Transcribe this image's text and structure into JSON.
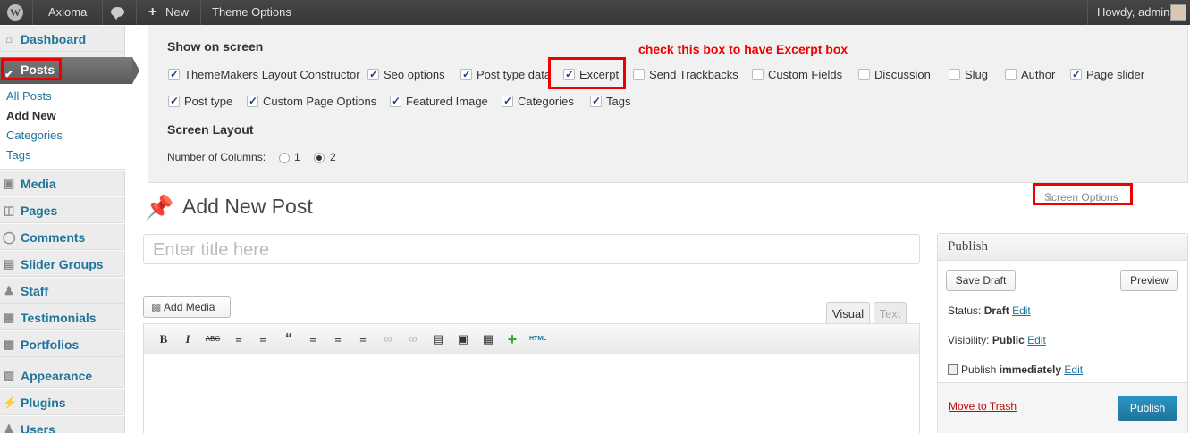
{
  "adminbar": {
    "site_name": "Axioma",
    "new_label": "New",
    "theme_options": "Theme Options",
    "howdy": "Howdy, admin"
  },
  "sidebar": {
    "dashboard": "Dashboard",
    "posts": "Posts",
    "submenu": [
      "All Posts",
      "Add New",
      "Categories",
      "Tags"
    ],
    "items": [
      "Media",
      "Pages",
      "Comments",
      "Slider Groups",
      "Staff",
      "Testimonials",
      "Portfolios",
      "Appearance",
      "Plugins",
      "Users"
    ]
  },
  "screen_options": {
    "show_on_screen": "Show on screen",
    "annotation": "check this box to have Excerpt box",
    "row1": [
      {
        "label": "ThemeMakers Layout Constructor",
        "checked": true
      },
      {
        "label": "Seo options",
        "checked": true
      },
      {
        "label": "Post type data",
        "checked": true
      },
      {
        "label": "Excerpt",
        "checked": true
      },
      {
        "label": "Send Trackbacks",
        "checked": false
      },
      {
        "label": "Custom Fields",
        "checked": false
      },
      {
        "label": "Discussion",
        "checked": false
      },
      {
        "label": "Slug",
        "checked": false
      },
      {
        "label": "Author",
        "checked": false
      },
      {
        "label": "Page slider",
        "checked": true
      }
    ],
    "row2": [
      {
        "label": "Post type",
        "checked": true
      },
      {
        "label": "Custom Page Options",
        "checked": true
      },
      {
        "label": "Featured Image",
        "checked": true
      },
      {
        "label": "Categories",
        "checked": true
      },
      {
        "label": "Tags",
        "checked": true
      }
    ],
    "screen_layout": "Screen Layout",
    "columns_label": "Number of Columns:",
    "col1": "1",
    "col2": "2",
    "selected_columns": "2",
    "tab_label": "Screen Options"
  },
  "main": {
    "page_title": "Add New Post",
    "title_placeholder": "Enter title here",
    "add_media": "Add Media",
    "tab_visual": "Visual",
    "tab_text": "Text",
    "toolbar_icons": [
      "bold-icon",
      "italic-icon",
      "strikethrough-icon",
      "bullet-list-icon",
      "numbered-list-icon",
      "blockquote-icon",
      "align-left-icon",
      "align-center-icon",
      "align-right-icon",
      "link-icon",
      "unlink-icon",
      "more-tag-icon",
      "fullscreen-icon",
      "kitchen-sink-icon",
      "plus-icon",
      "html-icon"
    ],
    "html_label": "HTML"
  },
  "publish": {
    "title": "Publish",
    "save_draft": "Save Draft",
    "preview": "Preview",
    "status_label": "Status:",
    "status_value": "Draft",
    "visibility_label": "Visibility:",
    "visibility_value": "Public",
    "publish_label": "Publish",
    "publish_value": "immediately",
    "edit": "Edit",
    "move_to_trash": "Move to Trash",
    "publish_button": "Publish"
  },
  "colors": {
    "accent": "#21759b",
    "annotation": "#ee0000"
  }
}
